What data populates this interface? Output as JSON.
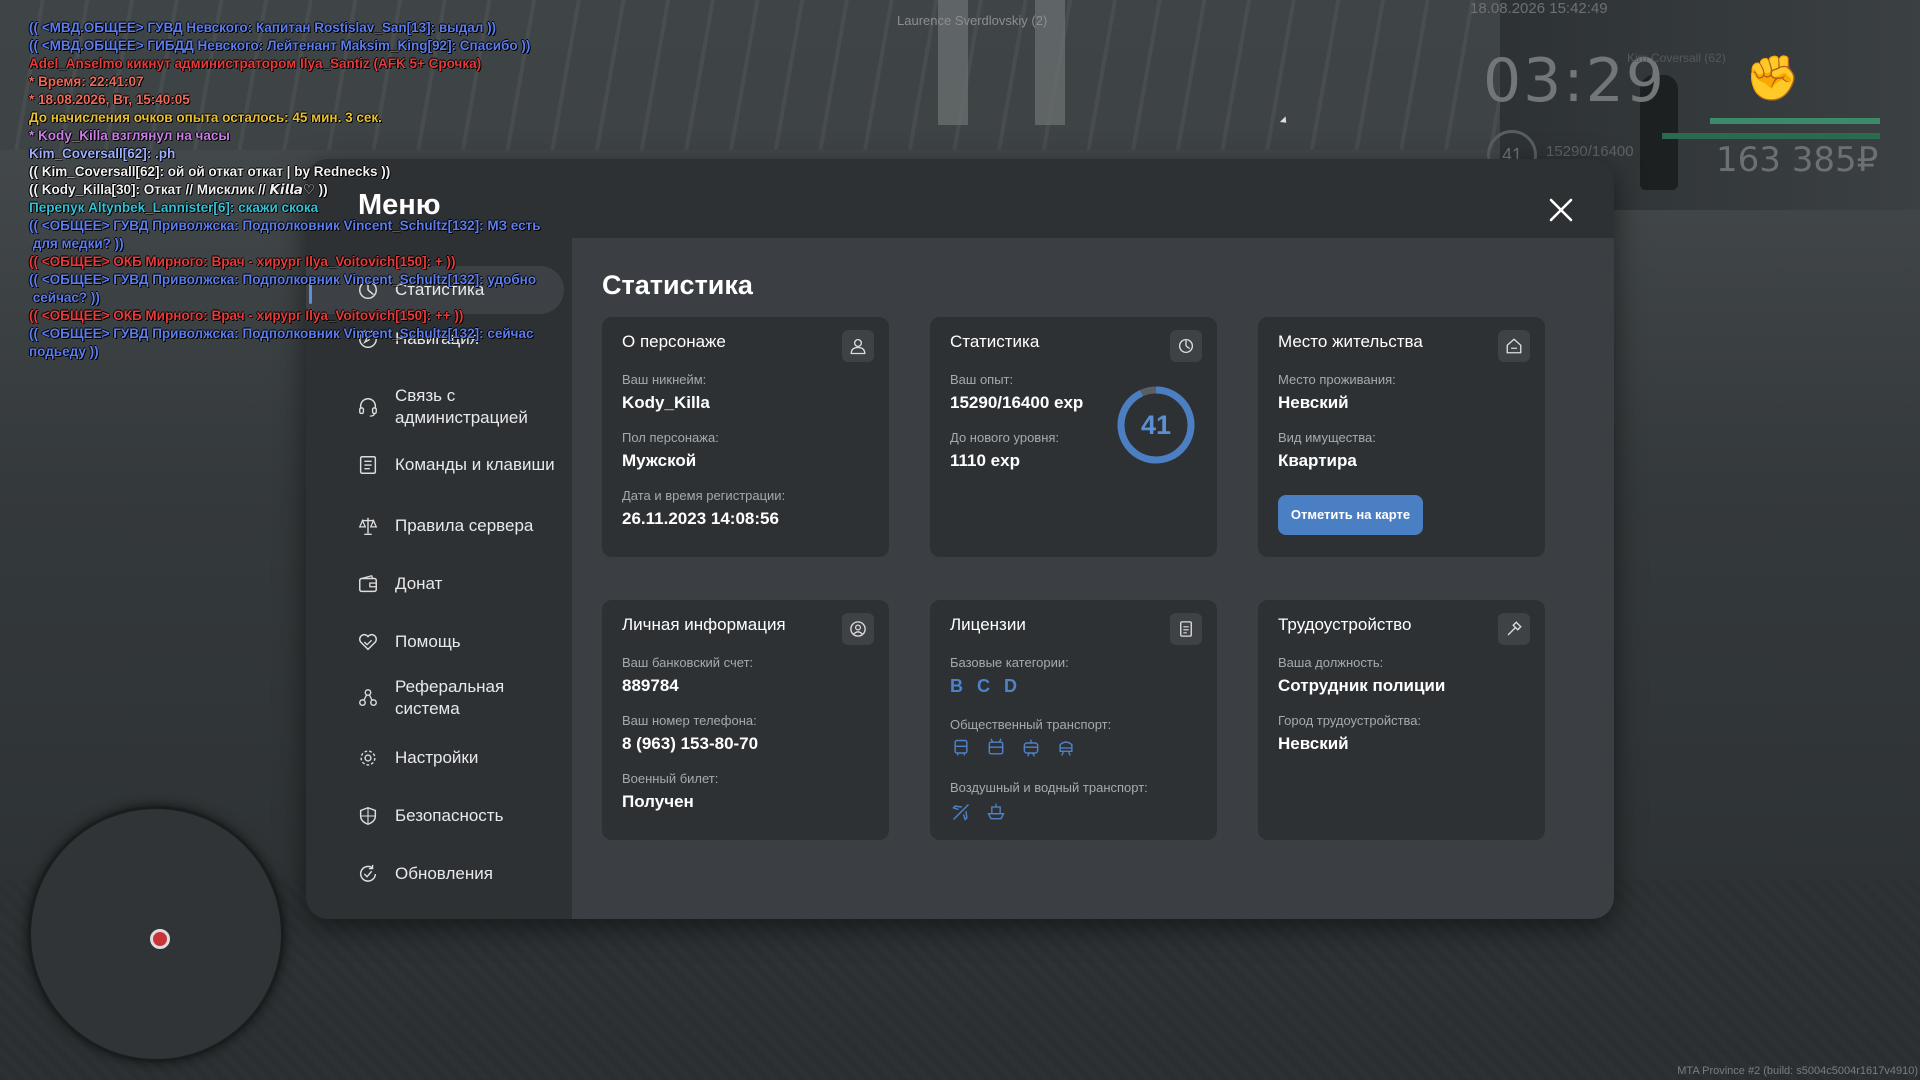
{
  "chat": [
    {
      "text": "(( <МВД.ОБЩЕЕ> ГУВД Невского: Капитан Rostislav_San[13]: выдал ))",
      "color": "#5b7df0"
    },
    {
      "text": "(( <МВД.ОБЩЕЕ> ГИБДД Невского: Лейтенант Maksim_King[92]: Спасибо ))",
      "color": "#5b7df0"
    },
    {
      "text": "Adel_Anselmo кикнут администратором Ilya_Santiz (AFK 5+ Срочка)",
      "color": "#e83a3a"
    },
    {
      "text": "* Время: 22:41:07",
      "color": "#f06a5a"
    },
    {
      "text": "* 18.08.2026, Вт, 15:40:05",
      "color": "#f06a5a"
    },
    {
      "text": "До начисления очков опыта осталось: 45 мин. 3 сек.",
      "color": "#e8c132"
    },
    {
      "text": "* Kody_Killa взглянул на часы",
      "color": "#c97ee6"
    },
    {
      "text": "Kim_Coversall[62]: .ph",
      "color": "#9cb0ff"
    },
    {
      "text": "(( Kim_Coversall[62]: ой ой откат откат | by Rednecks ))",
      "color": "#f0f0f0"
    },
    {
      "text": "(( Kody_Killa[30]: Откат // Мисклик // 𝙆𝙞𝙡𝙡𝙖♡ ))",
      "color": "#f0f0f0"
    },
    {
      "text": "Перепук Altynbek_Lannister[6]: скажи скока",
      "color": "#34c3d6"
    },
    {
      "text": "(( <ОБЩЕЕ> ГУВД Приволжска: Подполковник Vincent_Schultz[132]: МЗ есть",
      "color": "#5b7df0"
    },
    {
      "text": " для медки? ))",
      "color": "#5b7df0"
    },
    {
      "text": "(( <ОБЩЕЕ> ОКБ Мирного: Врач - хирург Ilya_Voitovich[150]: + ))",
      "color": "#e83a3a"
    },
    {
      "text": "(( <ОБЩЕЕ> ГУВД Приволжска: Подполковник Vincent_Schultz[132]: удобно",
      "color": "#5b7df0"
    },
    {
      "text": " сейчас? ))",
      "color": "#5b7df0"
    },
    {
      "text": "(( <ОБЩЕЕ> ОКБ Мирного: Врач - хирург Ilya_Voitovich[150]: ++ ))",
      "color": "#e83a3a"
    },
    {
      "text": "(( <ОБЩЕЕ> ГУВД Приволжска: Подполковник Vincent_Schultz[132]: сейчас",
      "color": "#5b7df0"
    },
    {
      "text": "подьеду ))",
      "color": "#5b7df0"
    }
  ],
  "hud": {
    "nearby_player": "Laurence Sverdlovskiy (2)",
    "datetime": "18.08.2026 15:42:49",
    "clock": "03:29",
    "player_tag": "Kim Coversall (62)",
    "level": "41",
    "exp": "15290/16400",
    "money": "163 385₽",
    "build": "MTA Province #2 (build: s5004c5004r1617v4910)"
  },
  "menu": {
    "title": "Меню",
    "nav": [
      {
        "label": "Статистика",
        "icon": "clock-icon",
        "active": true
      },
      {
        "label": "Навигация",
        "icon": "compass-icon"
      },
      {
        "label": "Связь с администрацией",
        "icon": "headset-icon"
      },
      {
        "label": "Команды и клавиши",
        "icon": "list-icon"
      },
      {
        "label": "Правила сервера",
        "icon": "scales-icon"
      },
      {
        "label": "Донат",
        "icon": "wallet-icon"
      },
      {
        "label": "Помощь",
        "icon": "handshake-heart-icon"
      },
      {
        "label": "Реферальная система",
        "icon": "referral-icon"
      },
      {
        "label": "Настройки",
        "icon": "gear-icon"
      },
      {
        "label": "Безопасность",
        "icon": "shield-icon"
      },
      {
        "label": "Обновления",
        "icon": "refresh-check-icon"
      }
    ],
    "page_title": "Статистика",
    "cards": {
      "character": {
        "title": "О персонаже",
        "nickname_label": "Ваш никнейм:",
        "nickname": "Kody_Killa",
        "gender_label": "Пол персонажа:",
        "gender": "Мужской",
        "reg_label": "Дата и время регистрации:",
        "reg": "26.11.2023 14:08:56"
      },
      "stats": {
        "title": "Статистика",
        "exp_label": "Ваш опыт:",
        "exp": "15290/16400 exp",
        "next_label": "До нового уровня:",
        "next": "1110 exp",
        "level": "41",
        "level_progress": 0.93
      },
      "residence": {
        "title": "Место жительства",
        "place_label": "Место проживания:",
        "place": "Невский",
        "property_label": "Вид имущества:",
        "property": "Квартира",
        "map_button": "Отметить на карте"
      },
      "personal": {
        "title": "Личная информация",
        "bank_label": "Ваш банковский счет:",
        "bank": "889784",
        "phone_label": "Ваш номер телефона:",
        "phone": "8 (963) 153-80-70",
        "military_label": "Военный билет:",
        "military": "Получен"
      },
      "licenses": {
        "title": "Лицензии",
        "basic_label": "Базовые категории:",
        "basic": [
          "B",
          "C",
          "D"
        ],
        "public_label": "Общественный транспорт:",
        "public_icons": [
          "bus-icon",
          "trolleybus-icon",
          "tram-icon",
          "train-icon"
        ],
        "air_label": "Воздушный и водный транспорт:",
        "air_icons": [
          "plane-icon",
          "boat-icon"
        ]
      },
      "employment": {
        "title": "Трудоустройство",
        "position_label": "Ваша должность:",
        "position": "Сотрудник полиции",
        "city_label": "Город трудоустройства:",
        "city": "Невский"
      }
    }
  }
}
